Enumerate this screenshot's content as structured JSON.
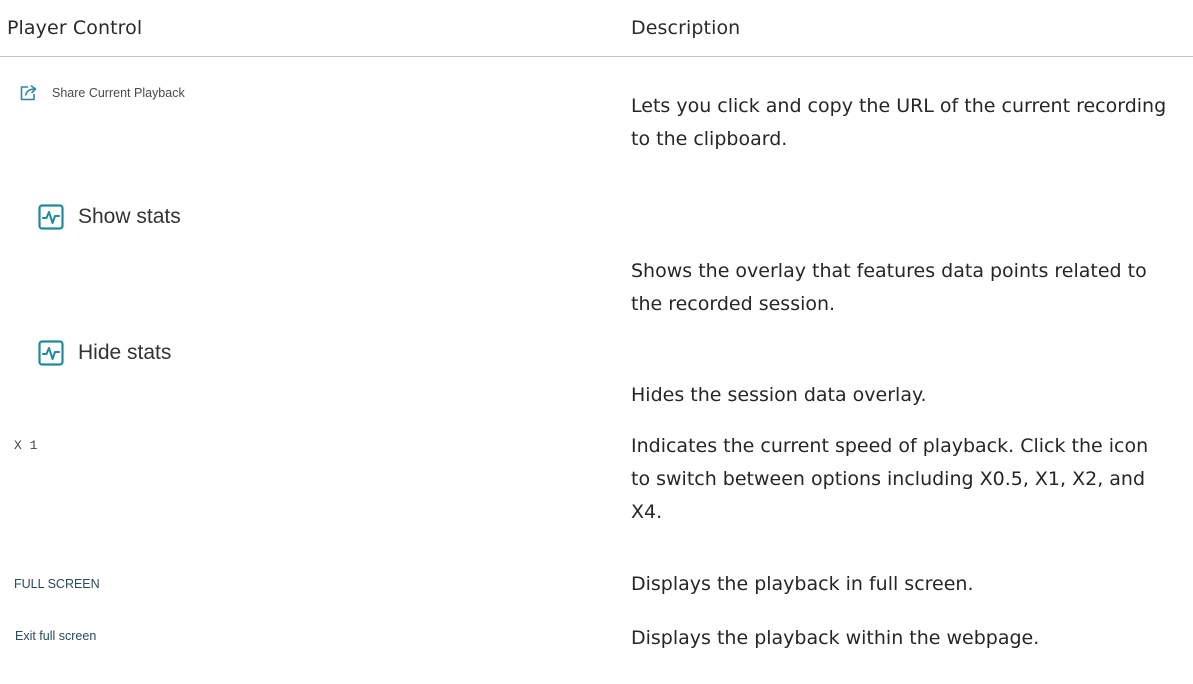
{
  "table": {
    "headers": {
      "control": "Player Control",
      "description": "Description"
    },
    "rows": [
      {
        "control_label": "Share Current Playback",
        "control_icon": "share-icon",
        "description": "Lets you click and copy the URL of the current recording to the clipboard."
      },
      {
        "control_label": "Show stats",
        "control_icon": "stats-icon",
        "description": "Shows the overlay that features data points related to the recorded session."
      },
      {
        "control_label": "Hide stats",
        "control_icon": "stats-icon",
        "description": "Hides the session data overlay."
      },
      {
        "control_label": "X 1",
        "description": "Indicates the current speed of playback. Click the icon to switch between options including X0.5, X1, X2, and X4."
      },
      {
        "control_label": "FULL SCREEN",
        "description": "Displays the playback in full screen."
      },
      {
        "control_label": "Exit full screen",
        "description": "Displays the playback within the webpage."
      }
    ]
  },
  "colors": {
    "stats_icon": "#1f8a9c",
    "share_icon": "#2d86a8",
    "fullscreen_label": "#264b5c",
    "rule": "#c4c4c4"
  }
}
